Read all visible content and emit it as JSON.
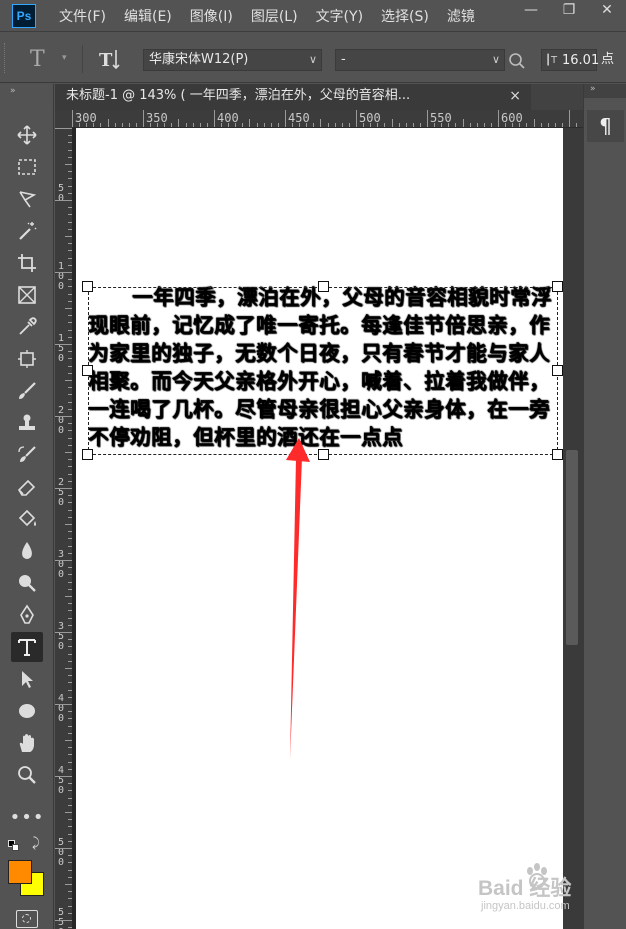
{
  "app": {
    "logo": "Ps"
  },
  "menu": [
    "文件(F)",
    "编辑(E)",
    "图像(I)",
    "图层(L)",
    "文字(Y)",
    "选择(S)",
    "滤镜"
  ],
  "window_controls": {
    "minimize": "—",
    "restore": "❐",
    "close": "✕"
  },
  "options": {
    "font_family": "华康宋体W12(P)",
    "font_style": "-",
    "font_size": "16.01",
    "font_size_unit": "点"
  },
  "document": {
    "tab_title": "未标题-1 @ 143% (      一年四季，漂泊在外，父母的音容相...",
    "close": "×"
  },
  "ruler": {
    "top_labels": [
      "300",
      "350",
      "400",
      "450",
      "500",
      "550",
      "600"
    ],
    "left_labels": [
      "5\n0",
      "1\n0\n0",
      "1\n5\n0",
      "2\n0\n0",
      "2\n5\n0",
      "3\n0\n0",
      "3\n5\n0",
      "4\n0\n0",
      "4\n5\n0",
      "5\n0\n0",
      "5\n5\n0"
    ]
  },
  "text_layer": {
    "content": "一年四季，漂泊在外，父母的音容相貌时常浮现眼前，记忆成了唯一寄托。每逢佳节倍思亲，作为家里的独子，无数个日夜，只有春节才能与家人相聚。而今天父亲格外开心，喊着、拉着我做伴，一连喝了几杯。尽管母亲很担心父亲身体，在一旁不停劝阻，但杯里的酒还在一点点"
  },
  "right_panel": {
    "paragraph_icon": "¶"
  },
  "colors": {
    "foreground": "#ff8a00",
    "background": "#ffff00",
    "arrow": "#ff2a2a"
  },
  "watermark": {
    "brand": "Baid 经验",
    "url": "jingyan.baidu.com"
  },
  "tools": [
    "move-icon",
    "marquee-icon",
    "lasso-icon",
    "magic-wand-icon",
    "crop-icon",
    "frame-icon",
    "eyedropper-icon",
    "healing-icon",
    "brush-icon",
    "stamp-icon",
    "history-brush-icon",
    "eraser-icon",
    "paint-bucket-icon",
    "blur-icon",
    "dodge-icon",
    "pen-icon",
    "type-icon",
    "path-select-icon",
    "ellipse-icon",
    "hand-icon",
    "zoom-icon",
    "more-icon"
  ]
}
